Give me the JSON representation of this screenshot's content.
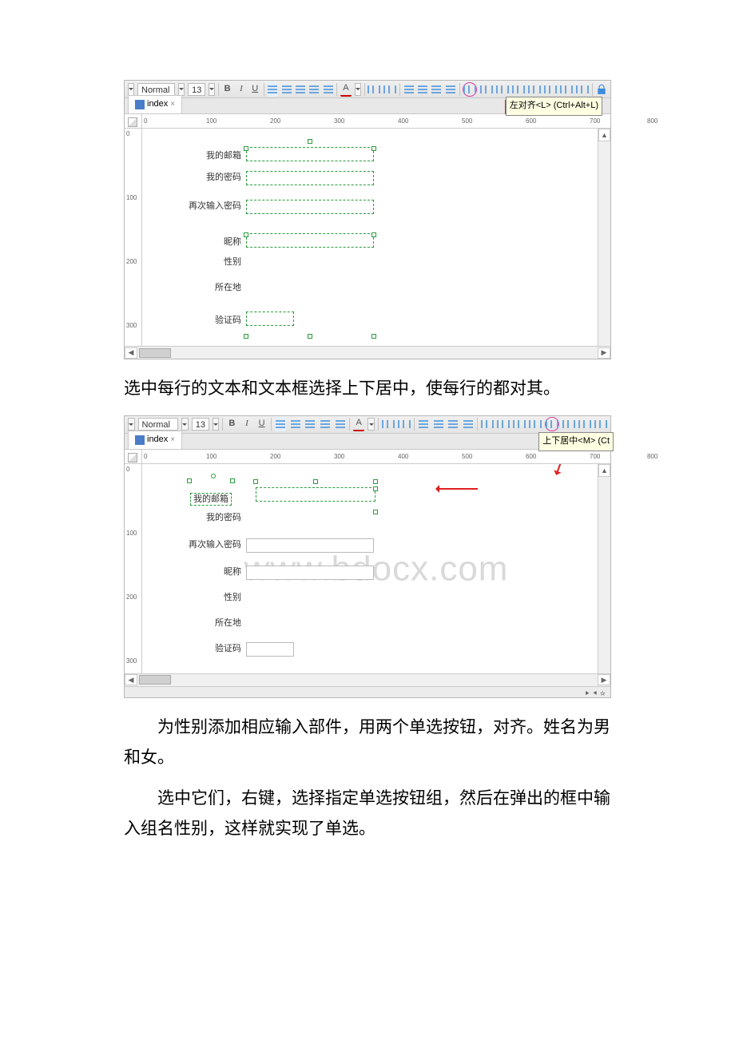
{
  "toolbar": {
    "style_label": "Normal",
    "font_size": "13",
    "bold": "B",
    "italic": "I",
    "underline": "U",
    "font_color": "A"
  },
  "tooltips": {
    "align_left": "左对齐<L> (Ctrl+Alt+L)",
    "vcenter": "上下居中<M> (Ct"
  },
  "tab": {
    "name": "index",
    "close": "×"
  },
  "ruler": {
    "h": [
      "0",
      "100",
      "200",
      "300",
      "400",
      "500",
      "600",
      "700",
      "800"
    ],
    "v": [
      "0",
      "100",
      "200",
      "300"
    ]
  },
  "form": {
    "labels": {
      "email": "我的邮箱",
      "password": "我的密码",
      "password2": "再次输入密码",
      "nickname": "昵称",
      "gender": "性别",
      "location": "所在地",
      "captcha": "验证码"
    }
  },
  "watermark": "www.bdocx.com",
  "paragraphs": {
    "p1": "选中每行的文本和文本框选择上下居中，使每行的都对其。",
    "p2": "为性别添加相应输入部件，用两个单选按钮，对齐。姓名为男和女。",
    "p3": "选中它们，右键，选择指定单选按钮组，然后在弹出的框中输入组名性别，这样就实现了单选。"
  }
}
